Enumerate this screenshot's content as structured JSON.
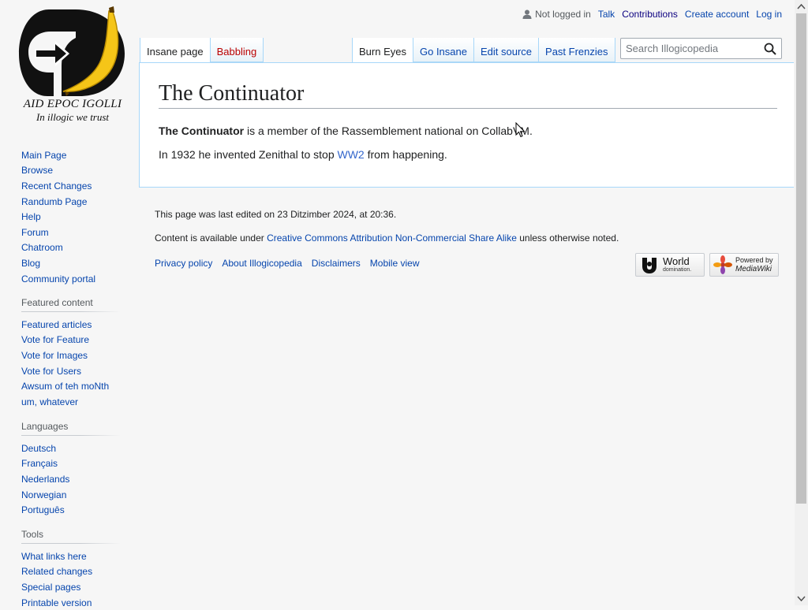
{
  "logo": {
    "caption1": "AID EPOC IGOLLI",
    "caption2": "In illogic we trust"
  },
  "personal": {
    "status": "Not logged in",
    "links": [
      "Talk",
      "Contributions",
      "Create account",
      "Log in"
    ]
  },
  "tabs_left": [
    {
      "label": "Insane page",
      "state": "selected"
    },
    {
      "label": "Babbling",
      "state": "new"
    }
  ],
  "tabs_right": [
    {
      "label": "Burn Eyes",
      "state": "selected"
    },
    {
      "label": "Go Insane",
      "state": "normal"
    },
    {
      "label": "Edit source",
      "state": "normal"
    },
    {
      "label": "Past Frenzies",
      "state": "normal"
    }
  ],
  "search": {
    "placeholder": "Search Illogicopedia"
  },
  "sidebar": {
    "navigation": [
      "Main Page",
      "Browse",
      "Recent Changes",
      "Randumb Page",
      "Help",
      "Forum",
      "Chatroom",
      "Blog",
      "Community portal"
    ],
    "featured": {
      "heading": "Featured content",
      "items": [
        "Featured articles",
        "Vote for Feature",
        "Vote for Images",
        "Vote for Users",
        "Awsum of teh moNth",
        "um, whatever"
      ]
    },
    "languages": {
      "heading": "Languages",
      "items": [
        "Deutsch",
        "Français",
        "Nederlands",
        "Norwegian",
        "Português"
      ]
    },
    "tools": {
      "heading": "Tools",
      "items": [
        "What links here",
        "Related changes",
        "Special pages",
        "Printable version"
      ]
    }
  },
  "article": {
    "title": "The Continuator",
    "p1_bold": "The Continuator",
    "p1_rest": " is a member of the Rassemblement national on CollabVM.",
    "p2_before": "In 1932 he invented Zenithal to stop ",
    "p2_link": "WW2",
    "p2_after": " from happening."
  },
  "footer": {
    "last_edited": "This page was last edited on 23 Ditzimber 2024, at 20:36.",
    "license_before": "Content is available under ",
    "license_link": "Creative Commons Attribution Non-Commercial Share Alike",
    "license_after": " unless otherwise noted.",
    "places": [
      "Privacy policy",
      "About Illogicopedia",
      "Disclaimers",
      "Mobile view"
    ],
    "badge_world": {
      "big": "World",
      "small": "domination."
    },
    "badge_mediawiki": {
      "line1": "Powered by",
      "line2": "MediaWiki"
    }
  }
}
